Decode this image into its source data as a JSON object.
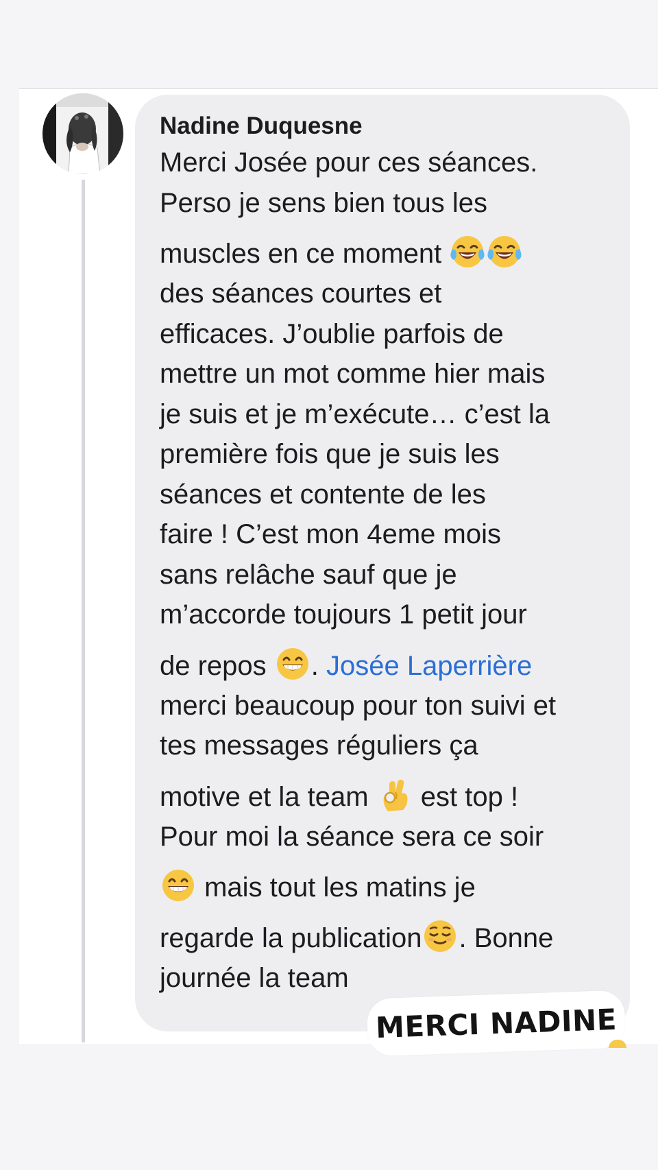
{
  "comment": {
    "author": "Nadine Duquesne",
    "avatar_icon": "profile-photo",
    "lines": [
      [
        {
          "t": "Merci Josée pour ces séances."
        }
      ],
      [
        {
          "t": "Perso je sens bien tous les"
        }
      ],
      [
        {
          "t": "muscles en ce moment "
        },
        {
          "e": "laugh"
        },
        {
          "e": "laugh"
        }
      ],
      [
        {
          "t": "des séances courtes et"
        }
      ],
      [
        {
          "t": "efficaces. J’oublie parfois de"
        }
      ],
      [
        {
          "t": "mettre un mot comme hier mais"
        }
      ],
      [
        {
          "t": "je suis et je m’exécute… c’est la"
        }
      ],
      [
        {
          "t": "première fois que je suis les"
        }
      ],
      [
        {
          "t": "séances et contente de les"
        }
      ],
      [
        {
          "t": "faire ! C’est mon 4eme mois"
        }
      ],
      [
        {
          "t": "sans relâche sauf que je"
        }
      ],
      [
        {
          "t": "m’accorde toujours 1 petit jour"
        }
      ],
      [
        {
          "t": "de repos "
        },
        {
          "e": "grin"
        },
        {
          "t": ". "
        },
        {
          "m": "Josée Laperrière"
        }
      ],
      [
        {
          "t": "merci beaucoup pour ton suivi et"
        }
      ],
      [
        {
          "t": "tes messages réguliers ça"
        }
      ],
      [
        {
          "t": "motive et la team "
        },
        {
          "e": "ok-hand"
        },
        {
          "t": " est top !"
        }
      ],
      [
        {
          "t": "Pour moi la séance sera ce soir"
        }
      ],
      [
        {
          "e": "grin"
        },
        {
          "t": " mais tout les matins je"
        }
      ],
      [
        {
          "t": "regarde la publication"
        },
        {
          "e": "relieved"
        },
        {
          "t": ". Bonne"
        }
      ],
      [
        {
          "t": "journée la team"
        }
      ]
    ]
  },
  "sticker": {
    "text": "MERCI NADINE"
  },
  "colors": {
    "background": "#f5f5f7",
    "bubble": "#eeeef1",
    "mention": "#2b6fd6",
    "text": "#1c1c1e"
  }
}
